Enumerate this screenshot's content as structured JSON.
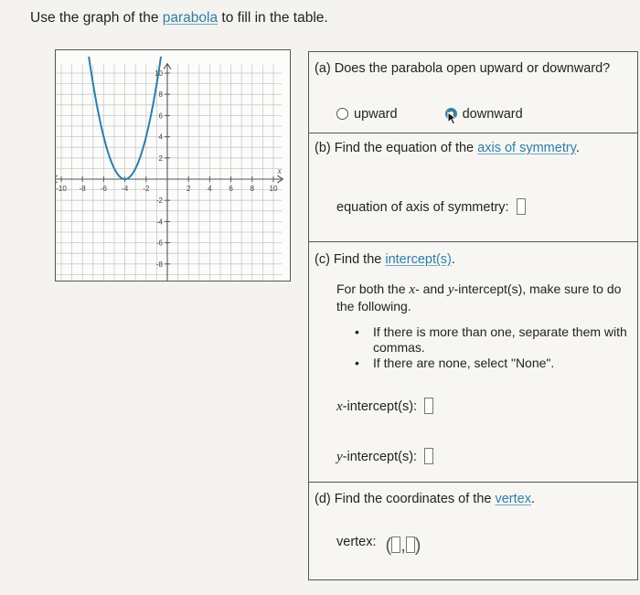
{
  "prompt": {
    "before": "Use the graph of the ",
    "link": "parabola",
    "after": " to fill in the table."
  },
  "graph": {
    "x_axis_label": "x",
    "x_ticks": [
      "-10",
      "-8",
      "-6",
      "-4",
      "-2",
      "2",
      "4",
      "6",
      "8",
      "10"
    ],
    "y_ticks": [
      "10",
      "8",
      "6",
      "4",
      "2",
      "-2",
      "-4",
      "-6",
      "-8",
      "-10"
    ],
    "curve_color": "#2f7ea6",
    "vertex": [
      -4,
      0
    ]
  },
  "part_a": {
    "question": "(a) Does the parabola open upward or downward?",
    "option_up": "upward",
    "option_down": "downward",
    "selected": "downward"
  },
  "part_b": {
    "question_before": "(b) Find the equation of the ",
    "question_link": "axis of symmetry",
    "question_after": ".",
    "field_label": "equation of axis of symmetry:"
  },
  "part_c": {
    "question_before": "(c) Find the ",
    "question_link": "intercept(s)",
    "question_after": ".",
    "instruction_1": "For both the ",
    "var_x": "x",
    "instruction_2": "- and ",
    "var_y": "y",
    "instruction_3": "-intercept(s), make sure to do the following.",
    "bullet_1": "If there is more than one, separate them with commas.",
    "bullet_2": "If there are none, select \"None\".",
    "x_label_suffix": "-intercept(s):",
    "y_label_suffix": "-intercept(s):"
  },
  "part_d": {
    "question_before": "(d) Find the coordinates of the ",
    "question_link": "vertex",
    "question_after": ".",
    "field_label": "vertex:",
    "open_paren": "(",
    "comma": ",",
    "close_paren": ")"
  }
}
